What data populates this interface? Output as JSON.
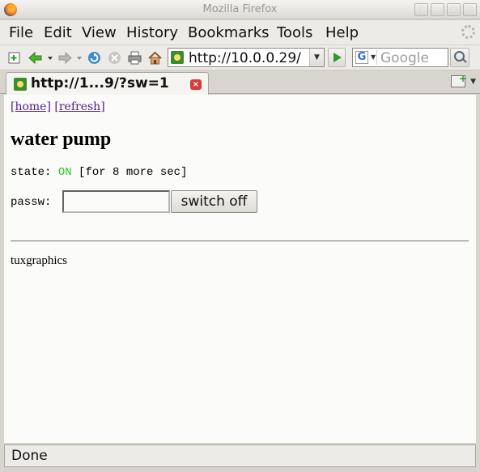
{
  "window": {
    "title": "Mozilla Firefox"
  },
  "menu": {
    "items": [
      "File",
      "Edit",
      "View",
      "History",
      "Bookmarks",
      "Tools",
      "Help"
    ]
  },
  "navbar": {
    "url": "http://10.0.0.29/",
    "search_placeholder": "Google",
    "search_engine_letter": "G"
  },
  "tab": {
    "title": "http://1...9/?sw=1"
  },
  "page": {
    "link_home": "[home]",
    "link_refresh": "[refresh]",
    "heading": "water pump",
    "state_label": "state:",
    "state_value": "ON",
    "state_suffix": "[for 8 more sec]",
    "state_color": "#20d020",
    "passw_label": "passw:",
    "passw_value": "",
    "button_label": "switch off",
    "footer": "tuxgraphics"
  },
  "status": {
    "text": "Done"
  }
}
